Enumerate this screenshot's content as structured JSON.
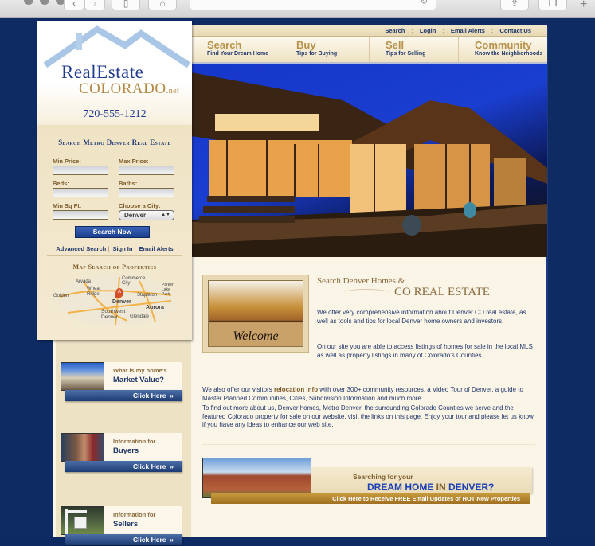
{
  "browser": {
    "back_icon": "chevron-left",
    "forward_icon": "chevron-right",
    "reload_icon": "reload",
    "share_icon": "share",
    "tabs_icon": "tabs",
    "new_tab_icon": "plus"
  },
  "topbar": {
    "links": [
      "Search",
      "Login",
      "Email Alerts",
      "Contact Us"
    ],
    "separator": ":"
  },
  "nav": [
    {
      "title": "Search",
      "subtitle": "Find Your Dream Home"
    },
    {
      "title": "Buy",
      "subtitle": "Tips for Buying"
    },
    {
      "title": "Sell",
      "subtitle": "Tips for Selling"
    },
    {
      "title": "Community",
      "subtitle": "Know the Neighborhoods"
    }
  ],
  "logo": {
    "line1": "RealEstate",
    "line2": "Colorado",
    "suffix": ".net",
    "phone": "720-555-1212"
  },
  "search": {
    "title": "Search Metro Denver Real Estate",
    "fields": {
      "min_price": {
        "label": "Min Price:",
        "value": ""
      },
      "max_price": {
        "label": "Max Price:",
        "value": ""
      },
      "beds": {
        "label": "Beds:",
        "value": ""
      },
      "baths": {
        "label": "Baths:",
        "value": ""
      },
      "min_sqft": {
        "label": "Min Sq Ft:",
        "value": ""
      },
      "city": {
        "label": "Choose a City:",
        "value": "Denver"
      }
    },
    "submit": "Search Now",
    "links": [
      "Advanced Search",
      "Sign In",
      "Email Alerts"
    ],
    "link_separator": "|"
  },
  "map": {
    "title": "Map Search of Properties",
    "labels": [
      "Arvada",
      "Commerce City",
      "Golden",
      "Wheat Ridge",
      "Denver",
      "Stapleton",
      "Aurora",
      "Southwest Denver",
      "Glendale",
      "Parker Lake Park"
    ],
    "marker": "A"
  },
  "promos": [
    {
      "subtitle": "What is my home's",
      "title": "Market Value?",
      "button": "Click Here"
    },
    {
      "subtitle": "Information for",
      "title": "Buyers",
      "button": "Click Here"
    },
    {
      "subtitle": "Information for",
      "title": "Sellers",
      "button": "Click Here"
    }
  ],
  "intro": {
    "welcome_mat": "Welcome",
    "heading_small": "Search Denver Homes &",
    "heading_large": "CO REAL ESTATE",
    "p1": "We offer very comprehensive information about Denver CO real estate, as well as tools and tips for local Denver home owners and investors.",
    "p2": "On our site you are able to access listings of homes for sale in the local MLS as well as property listings in many of Colorado's Counties.",
    "p3_pre": "We also offer our visitors ",
    "p3_bold": "relocation info",
    "p3_post": " with over 300+ community resources, a Video Tour of Denver, a guide to Master Planned Communities, Cities, Subdivision Information and much more...",
    "p4": "To find out more about us, Denver homes, Metro Denver, the surrounding Colorado Counties we serve and the featured Colorado property for sale on our website, visit the links on this page. Enjoy your tour and please let us know if you have any ideas to enhance our web site."
  },
  "dream": {
    "subtitle": "Searching for your",
    "title_a": "DREAM HOME ",
    "title_in": "IN",
    "title_b": " DENVER?",
    "button": "Click Here to Receive FREE Email Updates of HOT New Properties"
  },
  "colors": {
    "navy": "#0f2b64",
    "brand_blue": "#1f3669",
    "gold": "#b8914a",
    "cream": "#fbf5e8"
  }
}
